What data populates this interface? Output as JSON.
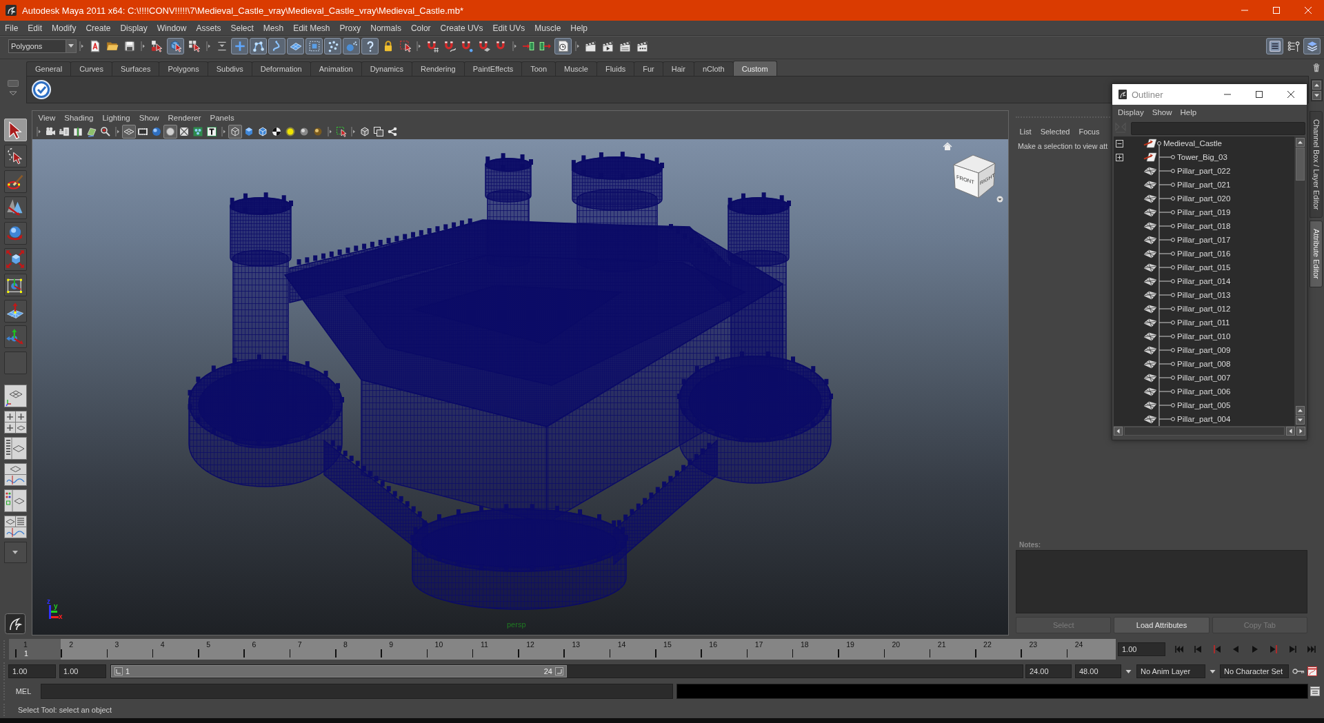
{
  "window": {
    "title": "Autodesk Maya 2011 x64: C:\\!!!!CONV!!!!!\\7\\Medieval_Castle_vray\\Medieval_Castle_vray\\Medieval_Castle.mb*"
  },
  "menu_bar": [
    "File",
    "Edit",
    "Modify",
    "Create",
    "Display",
    "Window",
    "Assets",
    "Select",
    "Mesh",
    "Edit Mesh",
    "Proxy",
    "Normals",
    "Color",
    "Create UVs",
    "Edit UVs",
    "Muscle",
    "Help"
  ],
  "status_line": {
    "menu_set": "Polygons",
    "selection_modes": [
      {
        "selected": false
      },
      {
        "selected": true
      },
      {
        "selected": false
      }
    ],
    "selection_masks": [
      {
        "on": true
      },
      {
        "on": true
      },
      {
        "on": true
      },
      {
        "on": true
      },
      {
        "on": true
      },
      {
        "on": true
      },
      {
        "on": true
      },
      {
        "on": true
      }
    ],
    "construction_history": {
      "on": true
    },
    "panel_toggles": [
      {
        "on": true
      },
      {
        "on": false
      },
      {
        "on": true
      }
    ]
  },
  "shelf": {
    "tabs": [
      {
        "label": "General",
        "selected": false
      },
      {
        "label": "Curves",
        "selected": false
      },
      {
        "label": "Surfaces",
        "selected": false
      },
      {
        "label": "Polygons",
        "selected": false
      },
      {
        "label": "Subdivs",
        "selected": false
      },
      {
        "label": "Deformation",
        "selected": false
      },
      {
        "label": "Animation",
        "selected": false
      },
      {
        "label": "Dynamics",
        "selected": false
      },
      {
        "label": "Rendering",
        "selected": false
      },
      {
        "label": "PaintEffects",
        "selected": false
      },
      {
        "label": "Toon",
        "selected": false
      },
      {
        "label": "Muscle",
        "selected": false
      },
      {
        "label": "Fluids",
        "selected": false
      },
      {
        "label": "Fur",
        "selected": false
      },
      {
        "label": "Hair",
        "selected": false
      },
      {
        "label": "nCloth",
        "selected": false
      },
      {
        "label": "Custom",
        "selected": true
      }
    ]
  },
  "tool_box": {
    "tools": [
      {
        "selected": true
      },
      {
        "selected": false
      },
      {
        "selected": false
      },
      {
        "selected": false
      },
      {
        "selected": false
      },
      {
        "selected": false
      },
      {
        "selected": false
      },
      {
        "selected": false
      },
      {
        "selected": false
      },
      {
        "selected": false
      }
    ]
  },
  "viewport": {
    "menus": [
      "View",
      "Shading",
      "Lighting",
      "Show",
      "Renderer",
      "Panels"
    ],
    "toolbar": [
      {
        "on": false
      },
      {
        "on": false
      },
      {
        "on": false
      },
      {
        "on": false
      },
      {
        "on": false
      },
      {
        "on": true
      },
      {
        "on": false
      },
      {
        "on": false
      },
      {
        "on": true
      },
      {
        "on": false
      },
      {
        "on": false
      },
      {
        "on": false
      },
      {
        "on": true
      },
      {
        "on": false
      },
      {
        "on": false
      },
      {
        "on": false
      },
      {
        "on": false
      },
      {
        "on": false
      },
      {
        "on": false
      },
      {
        "on": false
      },
      {
        "on": false
      },
      {
        "on": false
      },
      {
        "on": false
      }
    ],
    "view_cube": {
      "faces": [
        "FRONT",
        "RIGHT"
      ]
    },
    "axes": [
      {
        "label": "z",
        "color": "#3030ff"
      },
      {
        "label": "y",
        "color": "#20d020"
      },
      {
        "label": "x",
        "color": "#ff2020"
      }
    ],
    "camera": "persp"
  },
  "attribute_editor": {
    "tabs": [
      "List",
      "Selected",
      "Focus"
    ],
    "message": "Make a selection to view att",
    "notes_label": "Notes:",
    "buttons": [
      {
        "label": "Select",
        "disabled": true
      },
      {
        "label": "Load Attributes",
        "disabled": false
      },
      {
        "label": "Copy Tab",
        "disabled": true
      }
    ]
  },
  "side_tabs": [
    {
      "label": "Channel Box / Layer Editor",
      "selected": false
    },
    {
      "label": "Attribute Editor",
      "selected": true
    }
  ],
  "outliner": {
    "title": "Outliner",
    "menus": [
      "Display",
      "Show",
      "Help"
    ],
    "items": [
      {
        "label": "Medieval_Castle",
        "kind": "group",
        "expanded": true,
        "children": [
          {
            "label": "Tower_Big_03",
            "kind": "group",
            "expanded": false
          },
          {
            "label": "Pillar_part_022",
            "kind": "mesh"
          },
          {
            "label": "Pillar_part_021",
            "kind": "mesh"
          },
          {
            "label": "Pillar_part_020",
            "kind": "mesh"
          },
          {
            "label": "Pillar_part_019",
            "kind": "mesh"
          },
          {
            "label": "Pillar_part_018",
            "kind": "mesh"
          },
          {
            "label": "Pillar_part_017",
            "kind": "mesh"
          },
          {
            "label": "Pillar_part_016",
            "kind": "mesh"
          },
          {
            "label": "Pillar_part_015",
            "kind": "mesh"
          },
          {
            "label": "Pillar_part_014",
            "kind": "mesh"
          },
          {
            "label": "Pillar_part_013",
            "kind": "mesh"
          },
          {
            "label": "Pillar_part_012",
            "kind": "mesh"
          },
          {
            "label": "Pillar_part_011",
            "kind": "mesh"
          },
          {
            "label": "Pillar_part_010",
            "kind": "mesh"
          },
          {
            "label": "Pillar_part_009",
            "kind": "mesh"
          },
          {
            "label": "Pillar_part_008",
            "kind": "mesh"
          },
          {
            "label": "Pillar_part_007",
            "kind": "mesh"
          },
          {
            "label": "Pillar_part_006",
            "kind": "mesh"
          },
          {
            "label": "Pillar_part_005",
            "kind": "mesh"
          },
          {
            "label": "Pillar_part_004",
            "kind": "mesh"
          }
        ]
      }
    ]
  },
  "time_slider": {
    "frames": [
      {
        "label": "1",
        "current": true
      },
      {
        "label": "2",
        "current": false
      },
      {
        "label": "3",
        "current": false
      },
      {
        "label": "4",
        "current": false
      },
      {
        "label": "5",
        "current": false
      },
      {
        "label": "6",
        "current": false
      },
      {
        "label": "7",
        "current": false
      },
      {
        "label": "8",
        "current": false
      },
      {
        "label": "9",
        "current": false
      },
      {
        "label": "10",
        "current": false
      },
      {
        "label": "11",
        "current": false
      },
      {
        "label": "12",
        "current": false
      },
      {
        "label": "13",
        "current": false
      },
      {
        "label": "14",
        "current": false
      },
      {
        "label": "15",
        "current": false
      },
      {
        "label": "16",
        "current": false
      },
      {
        "label": "17",
        "current": false
      },
      {
        "label": "18",
        "current": false
      },
      {
        "label": "19",
        "current": false
      },
      {
        "label": "20",
        "current": false
      },
      {
        "label": "21",
        "current": false
      },
      {
        "label": "22",
        "current": false
      },
      {
        "label": "23",
        "current": false
      },
      {
        "label": "24",
        "current": false
      }
    ],
    "current_frame": "1",
    "current_time": "1.00"
  },
  "range_slider": {
    "start_time": "1.00",
    "playback_start": "1.00",
    "range_start": "1",
    "range_end": "24",
    "level": 0.5,
    "playback_end": "24.00",
    "end_time": "48.00",
    "anim_layer": "No Anim Layer",
    "character_set": "No Character Set"
  },
  "command_line": {
    "language": "MEL"
  },
  "help_line": "Select Tool: select an object"
}
